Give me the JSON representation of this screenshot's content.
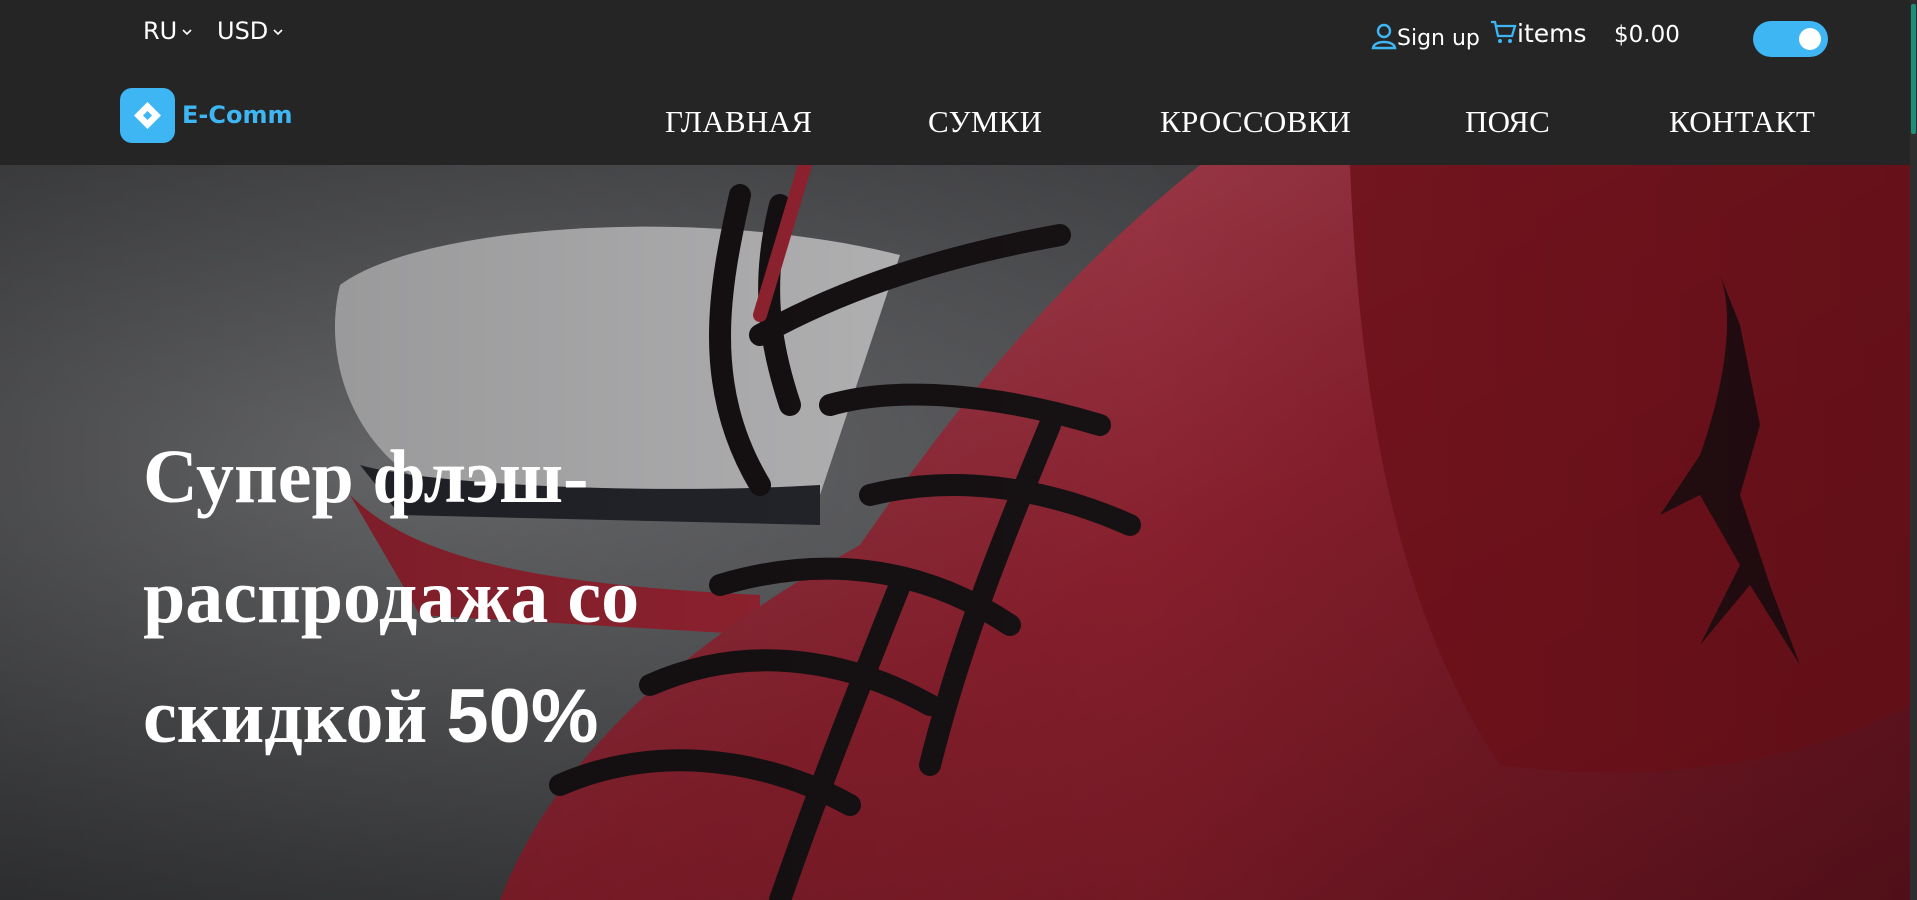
{
  "topbar": {
    "language": "RU",
    "currency": "USD",
    "signup_label": "Sign up",
    "cart_label": "items",
    "cart_total": "$0.00",
    "theme_toggle_on": true
  },
  "brand": {
    "name": "E-Comm",
    "color": "#3fb6f4"
  },
  "nav": {
    "items": [
      {
        "label": "ГЛАВНАЯ"
      },
      {
        "label": "СУМКИ"
      },
      {
        "label": "КРОССОВКИ"
      },
      {
        "label": "ПОЯС"
      },
      {
        "label": "КОНТАКТ"
      }
    ]
  },
  "hero": {
    "headline_line1": "Супер флэш-",
    "headline_line2": "распродажа со",
    "headline_line3": "скидкой",
    "headline_percent": "50%"
  },
  "colors": {
    "header_bg": "#252525",
    "accent": "#3fb6f4",
    "text": "#ffffff"
  }
}
